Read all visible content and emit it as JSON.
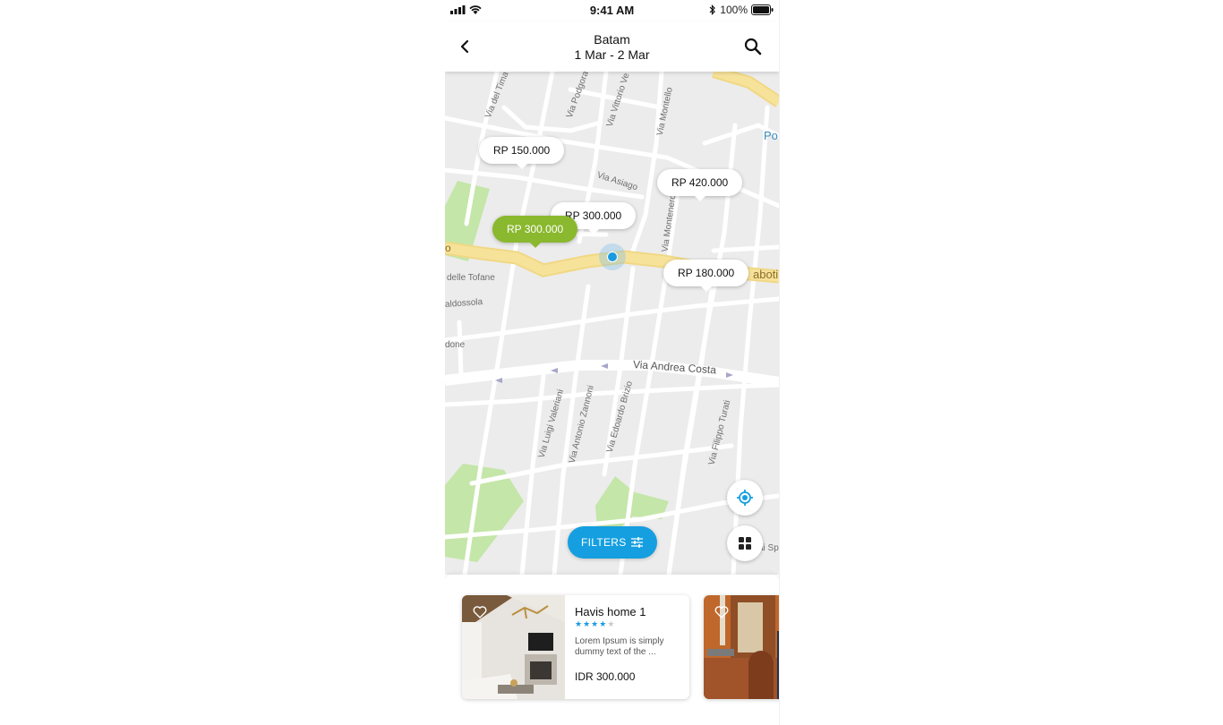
{
  "status_bar": {
    "time": "9:41 AM",
    "battery": "100%"
  },
  "header": {
    "city": "Batam",
    "dates": "1 Mar - 2 Mar"
  },
  "map": {
    "streets": [
      "Via Andrea Costa",
      "Via Montello",
      "Via Vittorio Ve",
      "Via Podgora",
      "Via del Timavo",
      "Via Asiago",
      "Via Montenero",
      "Via Luigi Valeriani",
      "Via Antonio Zannoni",
      "Via Edoardo Brizio",
      "Via Filippo Turati",
      "delle Tofane",
      "aldossola",
      "done",
      "aboti",
      "ai Sp",
      "Po",
      "o"
    ],
    "price_pins": [
      {
        "label": "RP 150.000",
        "active": false
      },
      {
        "label": "RP 420.000",
        "active": false
      },
      {
        "label": "RP 300.000",
        "active": false
      },
      {
        "label": "RP 300.000",
        "active": true
      },
      {
        "label": "RP 180.000",
        "active": false
      }
    ],
    "filters_label": "FILTERS"
  },
  "listings": [
    {
      "name": "Havis home 1",
      "rating": 4,
      "description": "Lorem Ipsum is simply dummy text of the ...",
      "price": "IDR 300.000"
    }
  ],
  "colors": {
    "accent": "#159fe0",
    "active_pin": "#8ab82e",
    "major_road": "#f7e29a",
    "park": "#c4e6a8",
    "star": "#1a9ae0"
  },
  "icons": [
    "back-arrow-icon",
    "search-icon",
    "locate-icon",
    "grid-view-icon",
    "filter-sliders-icon",
    "heart-icon",
    "star-icon"
  ]
}
